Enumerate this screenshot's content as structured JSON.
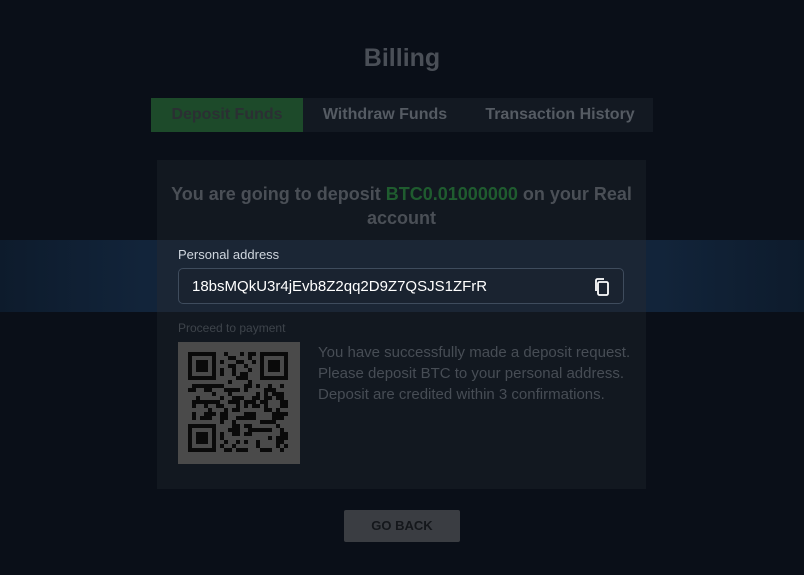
{
  "page": {
    "title": "Billing"
  },
  "tabs": [
    {
      "label": "Deposit Funds",
      "active": true
    },
    {
      "label": "Withdraw Funds",
      "active": false
    },
    {
      "label": "Transaction History",
      "active": false
    }
  ],
  "deposit": {
    "headline_prefix": "You are going to deposit",
    "amount": "BTC0.01000000",
    "headline_suffix": "on your Real account",
    "address_label": "Personal address",
    "address_value": "18bsMQkU3r4jEvb8Z2qq2D9Z7QSJS1ZFrR",
    "proceed_label": "Proceed to payment",
    "info_text": "You have successfully made a deposit request. Please deposit BTC to your personal address. Deposit are credited within 3 confirmations."
  },
  "icons": {
    "copy": "copy-icon",
    "qr": "qr-code"
  },
  "colors": {
    "accent_green": "#1f5c2f",
    "active_tab": "#1d4a2a"
  },
  "footer": {
    "go_back_label": "GO BACK"
  }
}
